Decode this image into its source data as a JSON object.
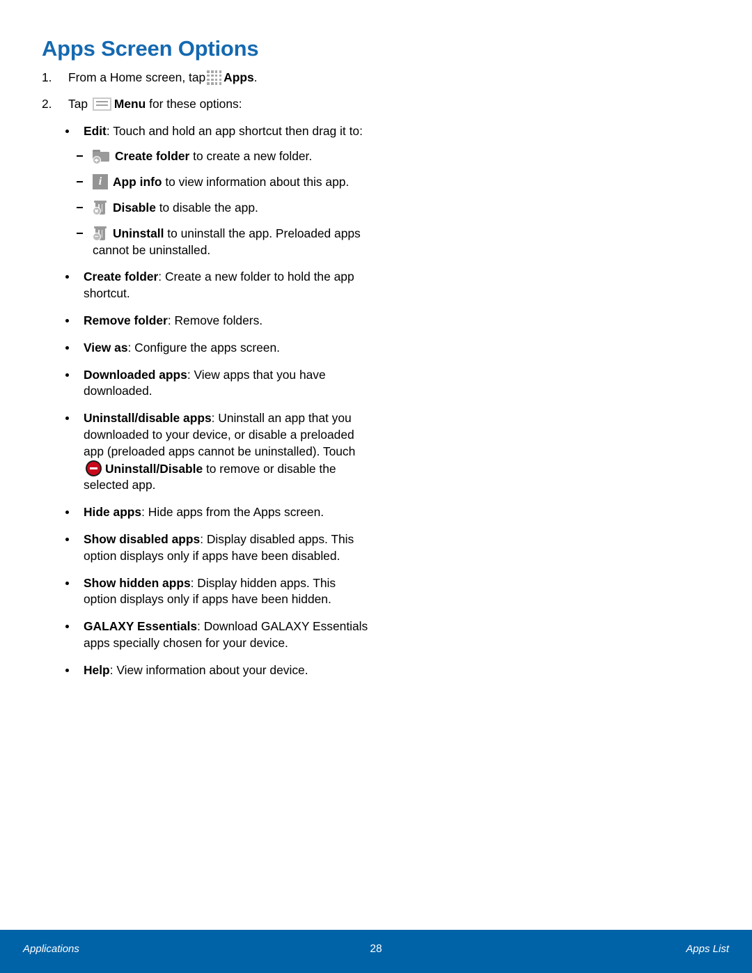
{
  "document": {
    "title": "Apps Screen Options",
    "title_color": "#1569b0"
  },
  "steps": [
    {
      "num": "1.",
      "text_before": "From a Home screen, tap",
      "icon": "apps-grid-icon",
      "bold_label": "Apps",
      "text_after": "."
    },
    {
      "num": "2.",
      "text_before": "Tap",
      "icon": "menu-icon",
      "bold_label": "Menu",
      "text_after": " for these options:"
    }
  ],
  "options": [
    {
      "label": "Edit",
      "text": ": Touch and hold an app shortcut then drag it to:",
      "subitems": [
        {
          "icon": "create-folder-icon",
          "label": "Create folder",
          "text": " to create a new folder."
        },
        {
          "icon": "app-info-icon",
          "label": "App info",
          "text": " to view information about this app."
        },
        {
          "icon": "disable-trash-icon",
          "label": "Disable",
          "text": " to disable the app."
        },
        {
          "icon": "uninstall-trash-icon",
          "label": "Uninstall",
          "text": " to uninstall the app. Preloaded apps cannot be uninstalled."
        }
      ]
    },
    {
      "label": "Create folder",
      "text": ": Create a new folder to hold the app shortcut."
    },
    {
      "label": "Remove folder",
      "text": ": Remove folders."
    },
    {
      "label": "View as",
      "text": ": Configure the apps screen."
    },
    {
      "label": "Downloaded apps",
      "text": ": View apps that you have downloaded."
    },
    {
      "label": "Uninstall/disable apps",
      "text_part1": ": Uninstall an app that you downloaded to your device, or disable a preloaded app (preloaded apps cannot be uninstalled). Touch ",
      "inline_icon": "uninstall-disable-red-icon",
      "inline_label": "Uninstall/Disable",
      "text_part2": " to remove or disable the selected app."
    },
    {
      "label": "Hide apps",
      "text": ": Hide apps from the Apps screen."
    },
    {
      "label": "Show disabled apps",
      "text": ": Display disabled apps. This option displays only if apps have been disabled."
    },
    {
      "label": "Show hidden apps",
      "text": ": Display hidden apps. This option displays only if apps have been hidden."
    },
    {
      "label": "GALAXY Essentials",
      "text": ": Download GALAXY Essentials apps specially chosen for your device."
    },
    {
      "label": "Help",
      "text": ": View information about your device."
    }
  ],
  "footer": {
    "left": "Applications",
    "center": "28",
    "right": "Apps List",
    "background_color": "#0063a8"
  }
}
